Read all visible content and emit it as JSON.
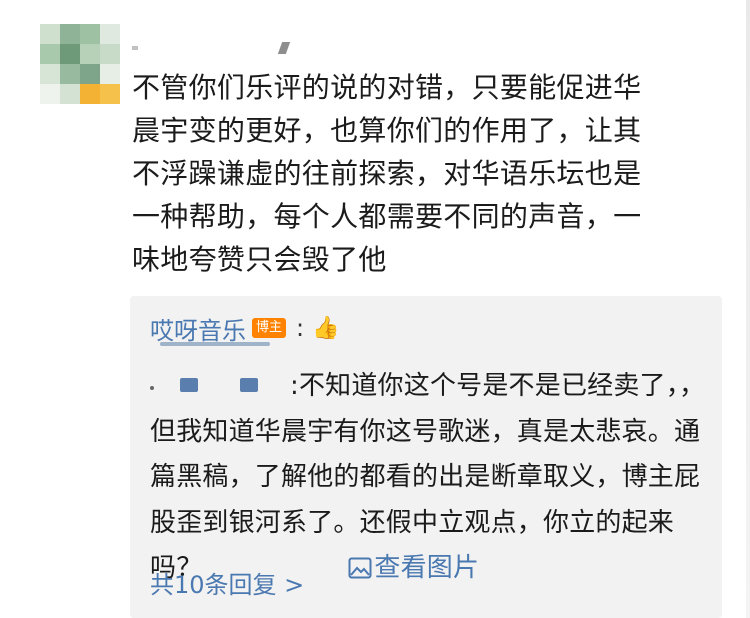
{
  "comment": {
    "text": "不管你们乐评的说的对错，只要能促进华\n晨宇变的更好，也算你们的作用了，让其\n不浮躁谦虚的往前探索，对华语乐坛也是\n一种帮助，每个人都需要不同的声音，一\n味地夸赞只会毁了他"
  },
  "reply": {
    "author": "哎呀音乐",
    "badge": "博主",
    "colon": ":",
    "text": ":不知道你这个号是不是已经卖了，，但我知道华晨宇有你这号歌迷，真是太悲哀。通篇黑稿，了解他的都看的出是断章取义，博主屁股歪到银河系了。还假中立观点，你立的起来吗？",
    "view_pic_label": "查看图片",
    "reply_count": "共10条回复 >"
  },
  "colors": {
    "link_blue": "#4a78b0",
    "badge_orange": "#ff8200",
    "reply_bg": "#f2f2f2"
  },
  "icons": [
    "thumbs-up-icon",
    "picture-icon"
  ]
}
